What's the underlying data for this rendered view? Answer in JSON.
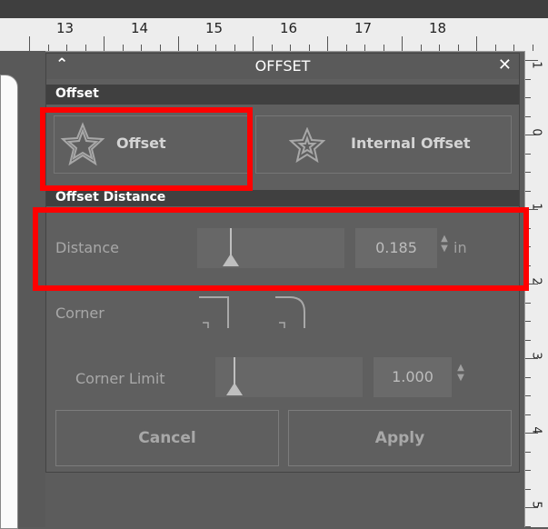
{
  "ruler_top": {
    "labels": [
      "13",
      "14",
      "15",
      "16",
      "17",
      "18"
    ]
  },
  "ruler_right": {
    "labels": [
      "1",
      "0",
      "1",
      "2",
      "3",
      "4",
      "5"
    ]
  },
  "dialog": {
    "title": "OFFSET",
    "collapse_icon": "chevron-up-icon",
    "close_icon": "close-icon",
    "section_offset": "Offset",
    "offset_button": "Offset",
    "internal_offset_button": "Internal Offset",
    "section_distance": "Offset Distance",
    "distance_label": "Distance",
    "distance_value": "0.185",
    "distance_unit": "in",
    "corner_label": "Corner",
    "corner_limit_label": "Corner Limit",
    "corner_limit_value": "1.000",
    "cancel_button": "Cancel",
    "apply_button": "Apply"
  },
  "colors": {
    "highlight": "#ff0000",
    "panel": "#5f5f5f",
    "section": "#404040"
  }
}
